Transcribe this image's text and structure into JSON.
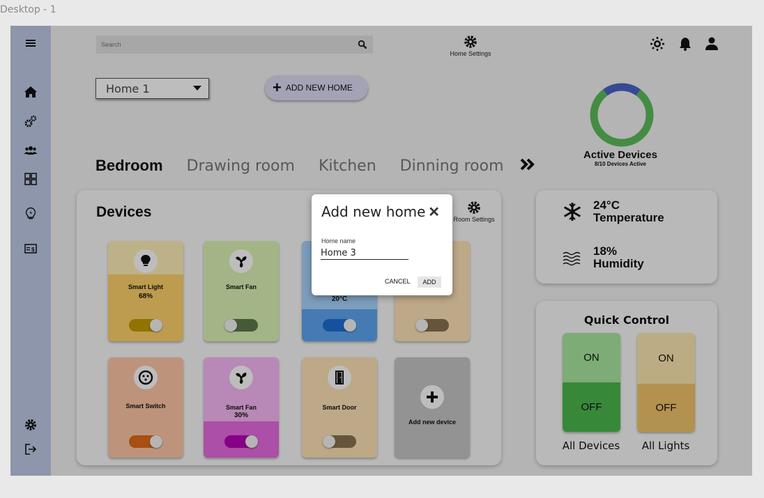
{
  "frame_title": "Desktop - 1",
  "search": {
    "placeholder": "Search"
  },
  "header": {
    "home_settings_label": "Home Settings"
  },
  "home_select": {
    "selected": "Home 1"
  },
  "add_home_button": {
    "label": "ADD NEW HOME"
  },
  "rooms": {
    "tabs": [
      "Bedroom",
      "Drawing room",
      "Kitchen",
      "Dinning room"
    ],
    "active": "Bedroom",
    "more_icon": "double-chevron-right-icon"
  },
  "active_devices": {
    "title": "Active Devices",
    "subtitle": "8/10 Devices Active",
    "active_fraction": 0.8,
    "colors": {
      "active": "#5cbd5c",
      "inactive": "#4a63c9"
    }
  },
  "devices": {
    "title": "Devices",
    "room_settings_label": "Room Settings",
    "cards": [
      {
        "name": "Smart Light",
        "value": "68%",
        "icon": "lightbulb-icon",
        "on": true
      },
      {
        "name": "Smart Fan",
        "value": "",
        "icon": "fan-icon",
        "on": false
      },
      {
        "name": "",
        "value": "20°C",
        "icon": "ac-icon",
        "on": true
      },
      {
        "name": "",
        "value": "",
        "icon": "device-icon",
        "on": false
      },
      {
        "name": "Smart Switch",
        "value": "",
        "icon": "socket-icon",
        "on": true
      },
      {
        "name": "Smart Fan",
        "value": "30%",
        "icon": "fan-icon",
        "on": true
      },
      {
        "name": "Smart Door",
        "value": "",
        "icon": "door-icon",
        "on": false
      }
    ],
    "add_device_label": "Add new device"
  },
  "environment": {
    "temperature_value": "24°C",
    "temperature_label": "Temperature",
    "humidity_value": "18%",
    "humidity_label": "Humidity"
  },
  "quick_control": {
    "title": "Quick Control",
    "groups": [
      {
        "label": "All Devices",
        "on": "ON",
        "off": "OFF"
      },
      {
        "label": "All Lights",
        "on": "ON",
        "off": "OFF"
      }
    ]
  },
  "modal": {
    "title": "Add new home",
    "field_label": "Home name",
    "field_value": "Home 3",
    "cancel": "CANCEL",
    "add": "ADD"
  }
}
